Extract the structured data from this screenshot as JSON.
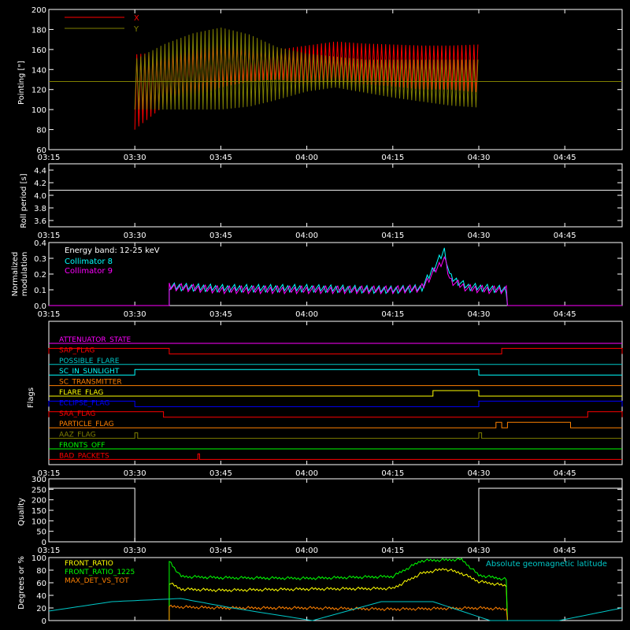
{
  "chart_data": [
    {
      "type": "line",
      "ylabel": "Pointing [\"]",
      "ylim": [
        60,
        200
      ],
      "yticks": [
        60,
        80,
        100,
        120,
        140,
        160,
        180,
        200
      ],
      "xlim": [
        "03:15",
        "04:55"
      ],
      "xticks": [
        "03:15",
        "03:30",
        "03:45",
        "04:00",
        "04:15",
        "04:30",
        "04:45"
      ],
      "legend": "top-left",
      "series": [
        {
          "name": "X",
          "color": "#ff0000",
          "x": [
            "03:30",
            "03:35",
            "03:40",
            "03:45",
            "03:50",
            "03:55",
            "04:00",
            "04:05",
            "04:10",
            "04:15",
            "04:20",
            "04:25",
            "04:30"
          ],
          "upper": [
            155,
            158,
            160,
            166,
            162,
            160,
            164,
            168,
            166,
            165,
            164,
            164,
            165
          ],
          "lower": [
            80,
            103,
            112,
            122,
            128,
            130,
            125,
            125,
            125,
            123,
            120,
            120,
            117
          ],
          "baseline": 128
        },
        {
          "name": "Y",
          "color": "#808000",
          "x": [
            "03:30",
            "03:35",
            "03:40",
            "03:45",
            "03:50",
            "03:55",
            "04:00",
            "04:05",
            "04:10",
            "04:15",
            "04:20",
            "04:25",
            "04:30"
          ],
          "upper": [
            150,
            165,
            176,
            182,
            175,
            162,
            156,
            153,
            150,
            150,
            150,
            150,
            150
          ],
          "lower": [
            100,
            100,
            100,
            100,
            103,
            110,
            118,
            122,
            117,
            112,
            108,
            104,
            102
          ],
          "baseline": 128
        }
      ]
    },
    {
      "type": "line",
      "ylabel": "Roll period [s]",
      "ylim": [
        3.5,
        4.5
      ],
      "yticks": [
        "3.6",
        "3.8",
        "4.0",
        "4.2",
        "4.4"
      ],
      "xticks": [
        "03:15",
        "03:30",
        "03:45",
        "04:00",
        "04:15",
        "04:30",
        "04:45"
      ],
      "series": [
        {
          "name": "",
          "color": "#ffffff",
          "value": 4.08
        }
      ]
    },
    {
      "type": "line",
      "ylabel": "Normalized modulation",
      "ylim": [
        0,
        0.4
      ],
      "yticks": [
        "0.0",
        "0.1",
        "0.2",
        "0.3",
        "0.4"
      ],
      "xticks": [
        "03:15",
        "03:30",
        "03:45",
        "04:00",
        "04:15",
        "04:30",
        "04:45"
      ],
      "annotation": "Energy band: 12-25 keV",
      "series": [
        {
          "name": "Collimator 8",
          "color": "#00ffff",
          "x": [
            "03:36",
            "03:45",
            "04:00",
            "04:15",
            "04:20",
            "04:24",
            "04:25",
            "04:28",
            "04:32",
            "04:35"
          ],
          "values": [
            0.12,
            0.11,
            0.11,
            0.1,
            0.11,
            0.35,
            0.18,
            0.12,
            0.11,
            0.1
          ]
        },
        {
          "name": "Collimator 9",
          "color": "#ff00ff",
          "x": [
            "03:36",
            "03:45",
            "04:00",
            "04:15",
            "04:20",
            "04:24",
            "04:25",
            "04:28",
            "04:32",
            "04:35"
          ],
          "values": [
            0.12,
            0.1,
            0.1,
            0.1,
            0.11,
            0.3,
            0.16,
            0.11,
            0.1,
            0.1
          ]
        }
      ]
    },
    {
      "type": "line",
      "ylabel": "Flags",
      "xticks": [
        "03:15",
        "03:30",
        "03:45",
        "04:00",
        "04:15",
        "04:30",
        "04:45"
      ],
      "flags": [
        {
          "name": "ATTENUATOR_STATE",
          "color": "#ff00ff",
          "segments": []
        },
        {
          "name": "SAP_FLAG",
          "color": "#ff0000",
          "segments": [
            [
              "03:15",
              "03:36"
            ],
            [
              "04:34",
              "04:55"
            ]
          ]
        },
        {
          "name": "POSSIBLE_FLARE",
          "color": "#00c8c8",
          "segments": []
        },
        {
          "name": "SC_IN_SUNLIGHT",
          "color": "#00ffff",
          "segments": [
            [
              "03:30",
              "04:30"
            ]
          ]
        },
        {
          "name": "SC_TRANSMITTER",
          "color": "#ff8000",
          "segments": []
        },
        {
          "name": "FLARE_FLAG",
          "color": "#ffff00",
          "segments": [
            [
              "04:22",
              "04:30"
            ]
          ]
        },
        {
          "name": "ECLIPSE_FLAG",
          "color": "#0000ff",
          "segments": [
            [
              "03:15",
              "03:30"
            ],
            [
              "04:30",
              "04:55"
            ]
          ]
        },
        {
          "name": "SAA_FLAG",
          "color": "#ff0000",
          "segments": [
            [
              "03:15",
              "03:35"
            ],
            [
              "04:49",
              "04:55"
            ]
          ]
        },
        {
          "name": "PARTICLE_FLAG",
          "color": "#ff8000",
          "segments": [
            [
              "04:33",
              "04:34"
            ],
            [
              "04:35",
              "04:46"
            ]
          ]
        },
        {
          "name": "AAZ_FLAG",
          "color": "#808000",
          "segments": [
            [
              "03:30",
              "03:30.5"
            ],
            [
              "04:30",
              "04:30.5"
            ]
          ]
        },
        {
          "name": "FRONTS_OFF",
          "color": "#00ff00",
          "segments": []
        },
        {
          "name": "BAD_PACKETS",
          "color": "#ff0000",
          "segments": [
            [
              "03:41",
              "03:41.3"
            ]
          ]
        }
      ]
    },
    {
      "type": "line",
      "ylabel": "Quality",
      "ylim": [
        0,
        300
      ],
      "yticks": [
        "0",
        "50",
        "100",
        "150",
        "200",
        "250",
        "300"
      ],
      "xticks": [
        "03:15",
        "03:30",
        "03:45",
        "04:00",
        "04:15",
        "04:30",
        "04:45"
      ],
      "series": [
        {
          "name": "",
          "color": "#ffffff",
          "x": [
            "03:15",
            "03:30",
            "03:30",
            "04:30",
            "04:30",
            "04:55"
          ],
          "values": [
            255,
            255,
            0,
            0,
            255,
            255
          ]
        }
      ]
    },
    {
      "type": "line",
      "ylabel": "Degrees or %",
      "ylim": [
        0,
        100
      ],
      "yticks": [
        "0",
        "20",
        "40",
        "60",
        "80",
        "100"
      ],
      "xticks": [
        "03:15",
        "03:30",
        "03:45",
        "04:00",
        "04:15",
        "04:30",
        "04:45"
      ],
      "annotation": "Absolute geomagnetic latitude",
      "series": [
        {
          "name": "FRONT_RATIO",
          "color": "#ffff00",
          "x": [
            "03:36",
            "03:38",
            "03:45",
            "04:00",
            "04:15",
            "04:20",
            "04:24",
            "04:27",
            "04:30",
            "04:35"
          ],
          "values": [
            60,
            50,
            48,
            50,
            51,
            75,
            82,
            75,
            62,
            55
          ]
        },
        {
          "name": "FRONT_RATIO_1225",
          "color": "#00ff00",
          "x": [
            "03:36",
            "03:38",
            "03:45",
            "04:00",
            "04:15",
            "04:20",
            "04:27",
            "04:30",
            "04:35"
          ],
          "values": [
            95,
            70,
            68,
            67,
            70,
            95,
            97,
            72,
            65
          ]
        },
        {
          "name": "MAX_DET_VS_TOT",
          "color": "#ff8000",
          "x": [
            "03:36",
            "03:45",
            "04:00",
            "04:15",
            "04:30",
            "04:35"
          ],
          "values": [
            22,
            20,
            20,
            18,
            20,
            18
          ]
        },
        {
          "name": "Absolute geomagnetic latitude",
          "color": "#00c8c8",
          "x": [
            "03:15",
            "03:26",
            "03:38",
            "03:47",
            "04:01",
            "04:13",
            "04:22",
            "04:32",
            "04:44",
            "04:55"
          ],
          "values": [
            15,
            30,
            35,
            20,
            0,
            30,
            30,
            0,
            0,
            20
          ]
        }
      ]
    }
  ]
}
